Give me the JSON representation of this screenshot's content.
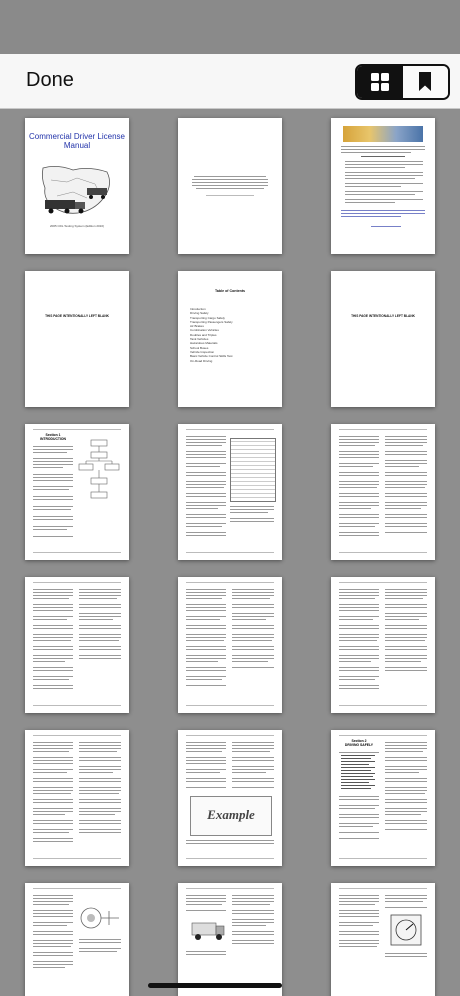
{
  "nav": {
    "done_label": "Done",
    "views": [
      {
        "name": "thumbnail-grid",
        "icon": "grid-icon",
        "selected": true
      },
      {
        "name": "bookmarks",
        "icon": "bookmark-icon",
        "selected": false
      }
    ]
  },
  "pages": {
    "cover": {
      "title": "Commercial Driver License Manual",
      "subtitle": "2005 CDL Testing System (Edition 2010)"
    },
    "blank_notice": "THIS PAGE INTENTIONALLY LEFT BLANK",
    "toc": {
      "heading": "Table of Contents",
      "entries": [
        "Introduction",
        "Driving Safely",
        "Transporting Cargo Safely",
        "Transporting Passengers Safely",
        "Air Brakes",
        "Combination Vehicles",
        "Doubles and Triples",
        "Tank Vehicles",
        "Hazardous Materials",
        "School Buses",
        "Vehicle Inspection",
        "Basic Vehicle Control Skills Test",
        "On-Road Driving"
      ]
    },
    "section1": {
      "label": "Section 1",
      "title": "INTRODUCTION"
    },
    "section2": {
      "label": "Section 2",
      "title": "DRIVING SAFELY"
    },
    "example_stamp": "Example"
  },
  "colors": {
    "title_blue": "#2233aa",
    "background": "#8e8e8e",
    "navbar": "#f7f7f7"
  }
}
